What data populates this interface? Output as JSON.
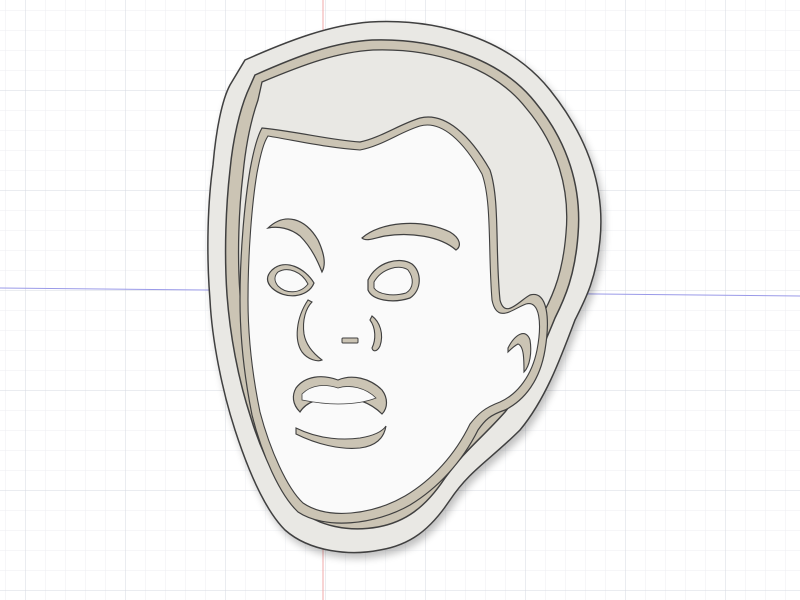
{
  "viewport": {
    "background": "#ffffff",
    "grid_minor_color": "#eceef2",
    "grid_major_color": "#d6d9e0",
    "axis_x_color": "#9a9ae8",
    "axis_y_color": "#f0a8a8"
  },
  "model": {
    "subject": "face-cookie-cutter",
    "body_color": "#e9e8e4",
    "wall_top_color": "#cbc4b4",
    "edge_color": "#3f3f3f",
    "face_fill": "#fafafa"
  }
}
